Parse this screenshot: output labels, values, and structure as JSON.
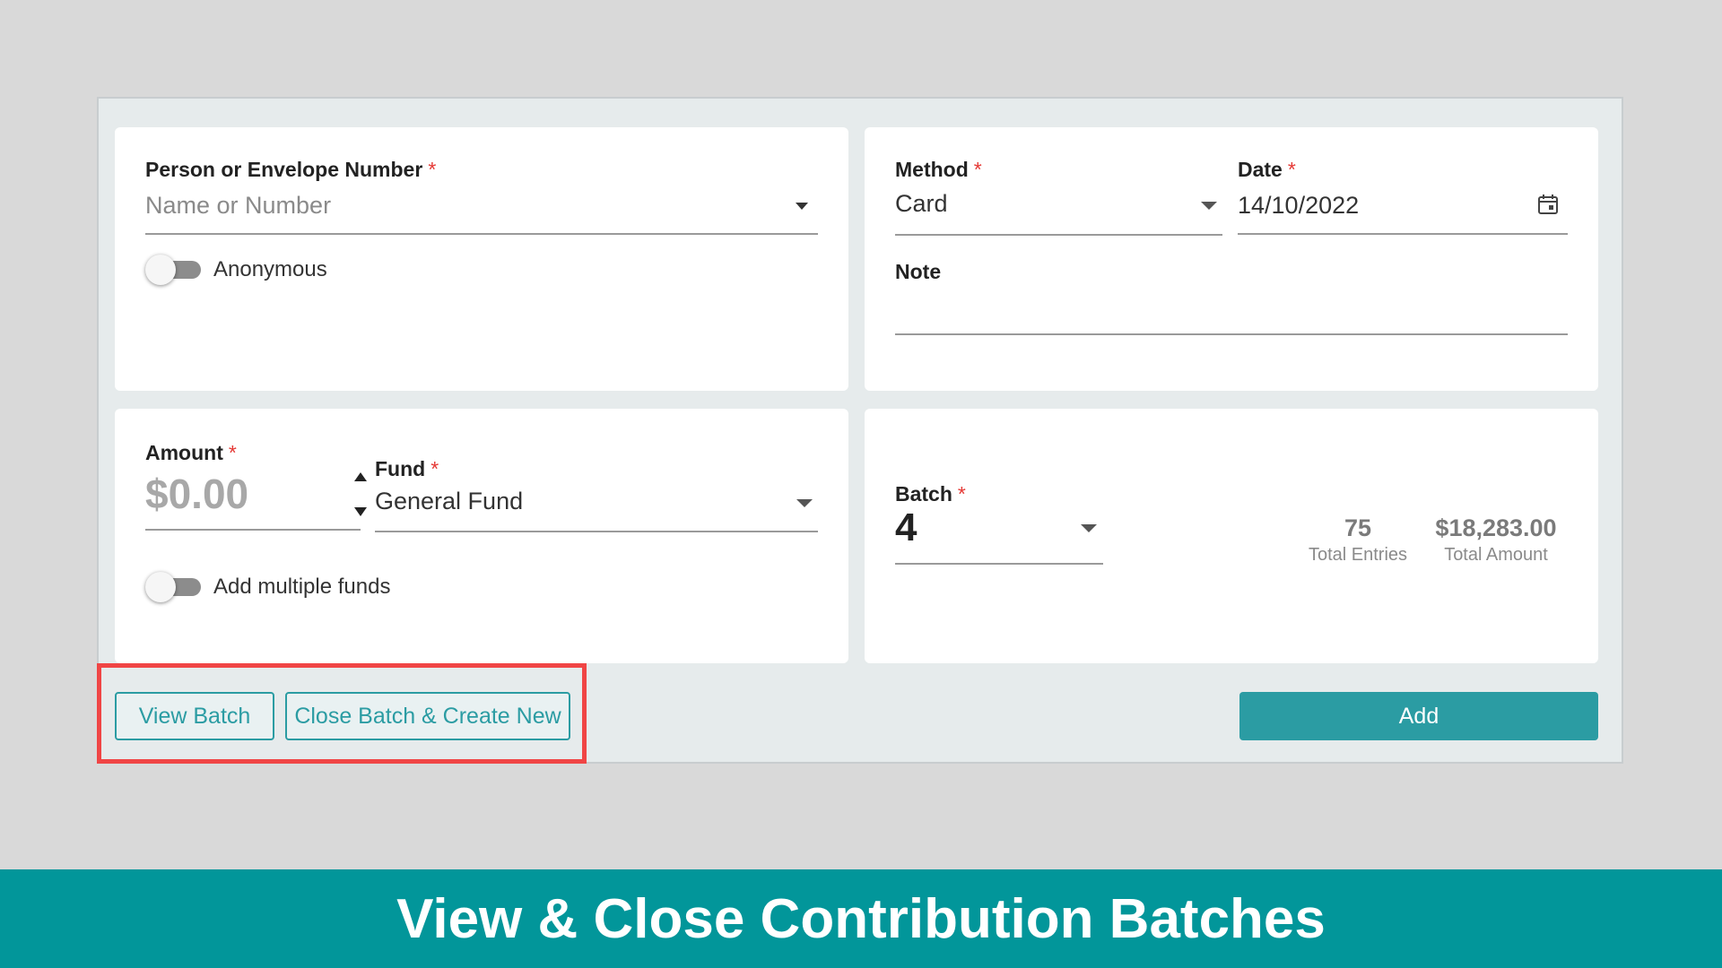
{
  "person": {
    "label": "Person or Envelope Number",
    "required_mark": "*",
    "placeholder": "Name or Number",
    "anonymous_label": "Anonymous",
    "anonymous_on": false
  },
  "method": {
    "label": "Method",
    "required_mark": "*",
    "value": "Card"
  },
  "date": {
    "label": "Date",
    "required_mark": "*",
    "value": "14/10/2022",
    "icon": "calendar-icon"
  },
  "note": {
    "label": "Note",
    "value": ""
  },
  "amount": {
    "label": "Amount",
    "required_mark": "*",
    "placeholder": "$0.00"
  },
  "fund": {
    "label": "Fund",
    "required_mark": "*",
    "value": "General Fund",
    "multiple_label": "Add multiple funds",
    "multiple_on": false
  },
  "batch": {
    "label": "Batch",
    "required_mark": "*",
    "value": "4",
    "total_entries": "75",
    "total_entries_label": "Total Entries",
    "total_amount": "$18,283.00",
    "total_amount_label": "Total Amount"
  },
  "actions": {
    "view_batch": "View Batch",
    "close_batch": "Close Batch & Create New",
    "add": "Add"
  },
  "banner": {
    "title": "View & Close Contribution Batches"
  },
  "colors": {
    "accent": "#2b9ca3",
    "banner": "#02969a",
    "required": "#e53935",
    "highlight": "#f04545"
  }
}
